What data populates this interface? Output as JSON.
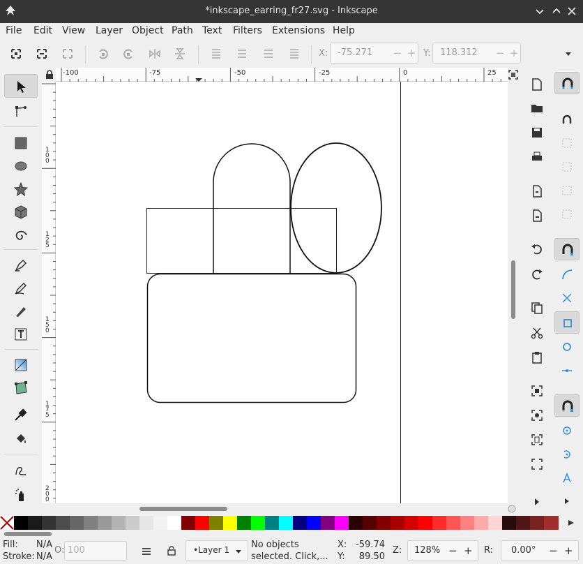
{
  "window": {
    "title": "*inkscape_earring_fr27.svg - Inkscape"
  },
  "menu": [
    "File",
    "Edit",
    "View",
    "Layer",
    "Object",
    "Path",
    "Text",
    "Filters",
    "Extensions",
    "Help"
  ],
  "controls": {
    "x_label": "X:",
    "x_value": "-75.271",
    "y_label": "Y:",
    "y_value": "118.312",
    "minus": "−",
    "plus": "+"
  },
  "ruler": {
    "top_labels": [
      "-100",
      "-75",
      "-50",
      "-25",
      "0",
      "25"
    ],
    "left_labels": [
      "100",
      "125",
      "150",
      "175",
      "200"
    ]
  },
  "palette": {
    "colors": [
      "#000000",
      "#1a1a1a",
      "#333333",
      "#4d4d4d",
      "#666666",
      "#808080",
      "#999999",
      "#b3b3b3",
      "#cccccc",
      "#e6e6e6",
      "#f2f2f2",
      "#ffffff",
      "#800000",
      "#ff0000",
      "#808000",
      "#ffff00",
      "#008000",
      "#00ff00",
      "#008080",
      "#00ffff",
      "#000080",
      "#0000ff",
      "#800080",
      "#ff00ff",
      "#2b0000",
      "#550000",
      "#800000",
      "#aa0000",
      "#d40000",
      "#ff0000",
      "#ff2a2a",
      "#ff5555",
      "#ff8080",
      "#ffaaaa",
      "#ffd5d5",
      "#280b0b",
      "#501616",
      "#782121",
      "#a02c2c"
    ]
  },
  "status": {
    "fill_label": "Fill:",
    "fill_value": "N/A",
    "stroke_label": "Stroke:",
    "stroke_value": "N/A",
    "opacity_label": "O:",
    "opacity_value": "100",
    "layer_name": "•Layer 1",
    "message_line1": "No objects",
    "message_line2": "selected. Click,...",
    "cursor_x_label": "X:",
    "cursor_x": "-59.74",
    "cursor_y_label": "Y:",
    "cursor_y": "89.50",
    "zoom_label": "Z:",
    "zoom_value": "128%",
    "rotate_label": "R:",
    "rotate_value": "0.00°"
  }
}
